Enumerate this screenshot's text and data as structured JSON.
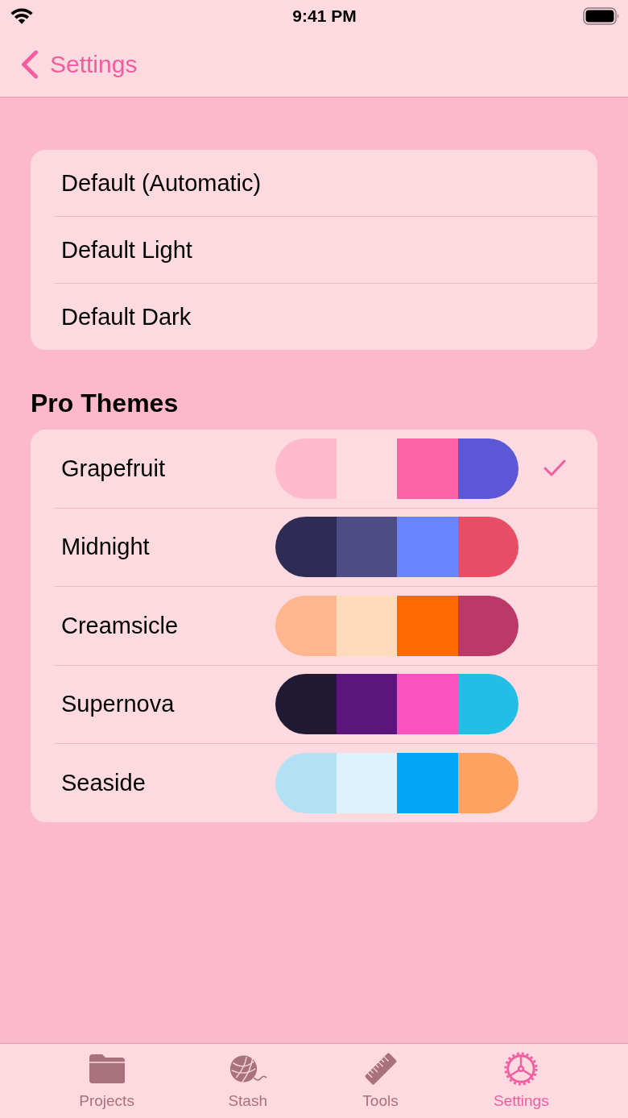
{
  "status_bar": {
    "time": "9:41 PM"
  },
  "nav": {
    "back_label": "Settings"
  },
  "default_themes": [
    {
      "label": "Default (Automatic)",
      "selected": false
    },
    {
      "label": "Default Light",
      "selected": false
    },
    {
      "label": "Default Dark",
      "selected": false
    }
  ],
  "pro_themes_header": "Pro Themes",
  "pro_themes": [
    {
      "label": "Grapefruit",
      "selected": true,
      "swatches": [
        {
          "color": "#feb9cc"
        },
        {
          "color": "#fddde2"
        },
        {
          "color": "#fe62a6"
        },
        {
          "color": "#5b57d6"
        }
      ]
    },
    {
      "label": "Midnight",
      "selected": false,
      "swatches": [
        {
          "color": "#2e2c54"
        },
        {
          "color": "#4e4c84"
        },
        {
          "color": "#6884fe"
        },
        {
          "color": "#e74d64"
        }
      ]
    },
    {
      "label": "Creamsicle",
      "selected": false,
      "swatches": [
        {
          "color": "#feb68e"
        },
        {
          "color": "#fedbbb"
        },
        {
          "color": "#fe6a02"
        },
        {
          "color": "#bb3966"
        }
      ]
    },
    {
      "label": "Supernova",
      "selected": false,
      "swatches": [
        {
          "color": "#201a34"
        },
        {
          "color": "#5c157d"
        },
        {
          "color": "#fa52be"
        },
        {
          "color": "#23bee6"
        }
      ]
    },
    {
      "label": "Seaside",
      "selected": false,
      "swatches": [
        {
          "color": "#b3e1f4"
        },
        {
          "color": "#dcf2fc"
        },
        {
          "color": "#02a6f4"
        },
        {
          "color": "#fea262"
        }
      ]
    }
  ],
  "tab_bar": [
    {
      "label": "Projects",
      "kind": "folder",
      "selected": false
    },
    {
      "label": "Stash",
      "kind": "yarn",
      "selected": false
    },
    {
      "label": "Tools",
      "kind": "ruler",
      "selected": false
    },
    {
      "label": "Settings",
      "kind": "gear",
      "selected": true
    }
  ]
}
